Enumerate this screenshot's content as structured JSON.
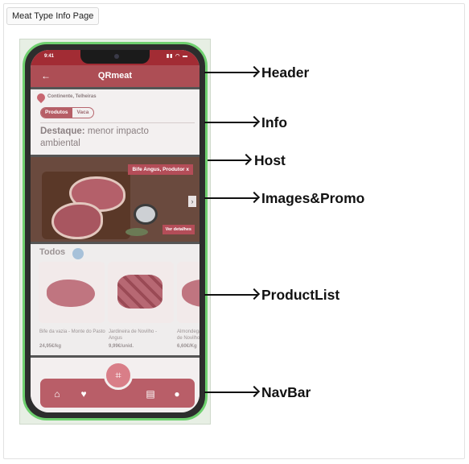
{
  "page_label": "Meat Type Info Page",
  "phone": {
    "status_time": "9:41",
    "app_title": "QRmeat",
    "info": {
      "location": "Continente, Telheiras",
      "chips": [
        "Produtos",
        "Vaca"
      ],
      "highlight_label": "Destaque:",
      "highlight_text": "menor impacto ambiental"
    },
    "host": {
      "promo_tag": "Bife Angus, Produtor x",
      "details_button": "Ver detalhes"
    },
    "products": {
      "title": "Todos",
      "items": [
        {
          "name": "Bife da vazia - Monte do Pasto",
          "price": "24,95€/kg"
        },
        {
          "name": "Jardineira de Novilho - Angus",
          "price": "9,99€/unid."
        },
        {
          "name": "Almondegas de Novilho",
          "price": "6,60€/Kg"
        }
      ]
    }
  },
  "callouts": [
    "Header",
    "Info",
    "Host",
    "Images&Promo",
    "ProductList",
    "NavBar"
  ],
  "colors": {
    "brand": "#ad4e55",
    "outline": "#6fd06f"
  }
}
